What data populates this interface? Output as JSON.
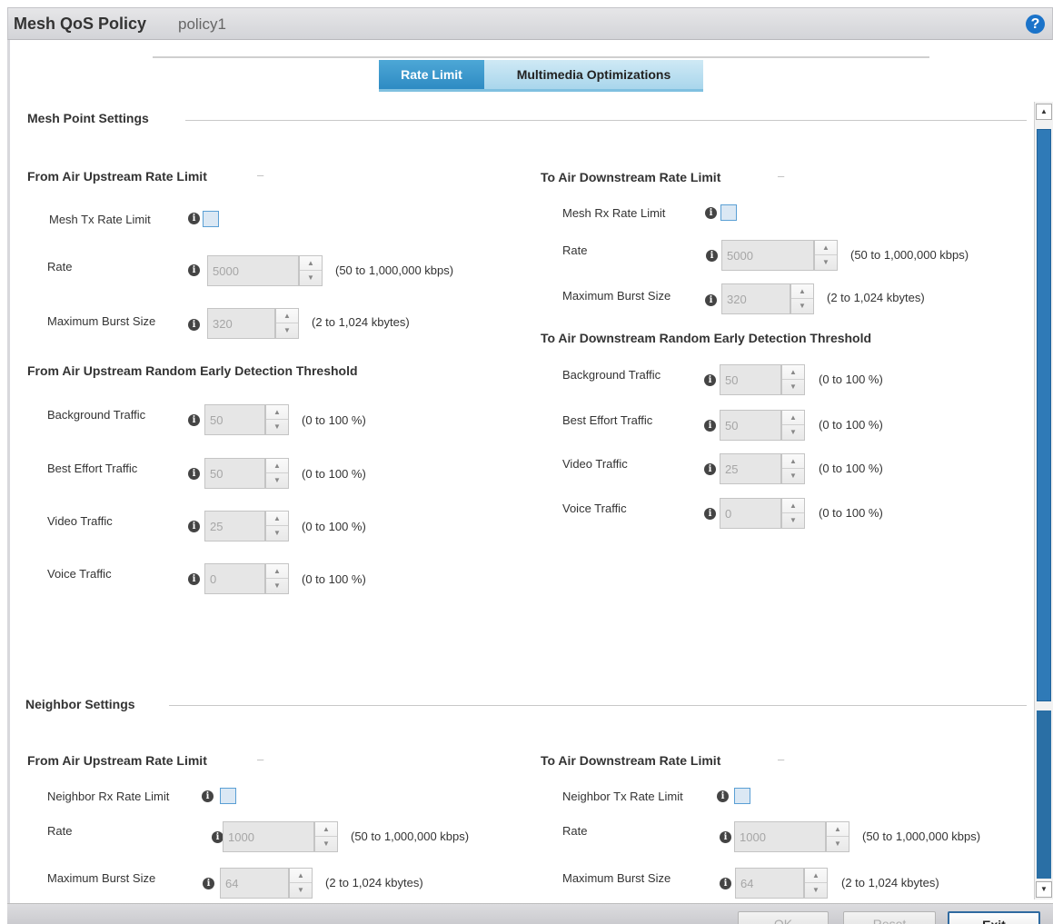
{
  "header": {
    "title": "Mesh QoS Policy",
    "policy_name": "policy1",
    "help_icon": "?"
  },
  "tabs": [
    {
      "label": "Rate Limit",
      "active": true
    },
    {
      "label": "Multimedia Optimizations",
      "active": false
    }
  ],
  "info_glyph": "i",
  "spinner": {
    "up": "▲",
    "down": "▼"
  },
  "mesh_point": {
    "title": "Mesh Point Settings",
    "up": {
      "title": "From Air Upstream Rate Limit",
      "dash": "–",
      "enable_label": "Mesh Tx Rate Limit",
      "rate_label": "Rate",
      "rate_value": "5000",
      "rate_range": "(50 to 1,000,000 kbps)",
      "burst_label": "Maximum Burst Size",
      "burst_value": "320",
      "burst_range": "(2 to 1,024 kbytes)"
    },
    "up_red": {
      "title": "From Air Upstream Random Early Detection Threshold",
      "rows": [
        {
          "label": "Background Traffic",
          "value": "50",
          "range": "(0 to 100 %)"
        },
        {
          "label": "Best Effort Traffic",
          "value": "50",
          "range": "(0 to 100 %)"
        },
        {
          "label": "Video Traffic",
          "value": "25",
          "range": "(0 to 100 %)"
        },
        {
          "label": "Voice Traffic",
          "value": "0",
          "range": "(0 to 100 %)"
        }
      ]
    },
    "down": {
      "title": "To Air Downstream Rate Limit",
      "dash": "–",
      "enable_label": "Mesh Rx Rate Limit",
      "rate_label": "Rate",
      "rate_value": "5000",
      "rate_range": "(50 to 1,000,000 kbps)",
      "burst_label": "Maximum Burst Size",
      "burst_value": "320",
      "burst_range": "(2 to 1,024 kbytes)"
    },
    "down_red": {
      "title": "To Air Downstream Random Early Detection Threshold",
      "rows": [
        {
          "label": "Background Traffic",
          "value": "50",
          "range": "(0 to 100 %)"
        },
        {
          "label": "Best Effort Traffic",
          "value": "50",
          "range": "(0 to 100 %)"
        },
        {
          "label": "Video Traffic",
          "value": "25",
          "range": "(0 to 100 %)"
        },
        {
          "label": "Voice Traffic",
          "value": "0",
          "range": "(0 to 100 %)"
        }
      ]
    }
  },
  "neighbor": {
    "title": "Neighbor Settings",
    "up": {
      "title": "From Air Upstream Rate Limit",
      "dash": "–",
      "enable_label": "Neighbor Rx Rate Limit",
      "rate_label": "Rate",
      "rate_value": "1000",
      "rate_range": "(50 to 1,000,000 kbps)",
      "burst_label": "Maximum Burst Size",
      "burst_value": "64",
      "burst_range": "(2 to 1,024 kbytes)"
    },
    "down": {
      "title": "To Air Downstream Rate Limit",
      "dash": "–",
      "enable_label": "Neighbor Tx Rate Limit",
      "rate_label": "Rate",
      "rate_value": "1000",
      "rate_range": "(50 to 1,000,000 kbps)",
      "burst_label": "Maximum Burst Size",
      "burst_value": "64",
      "burst_range": "(2 to 1,024 kbytes)"
    }
  },
  "footer": {
    "ok": "OK",
    "reset": "Reset",
    "exit": "Exit"
  }
}
